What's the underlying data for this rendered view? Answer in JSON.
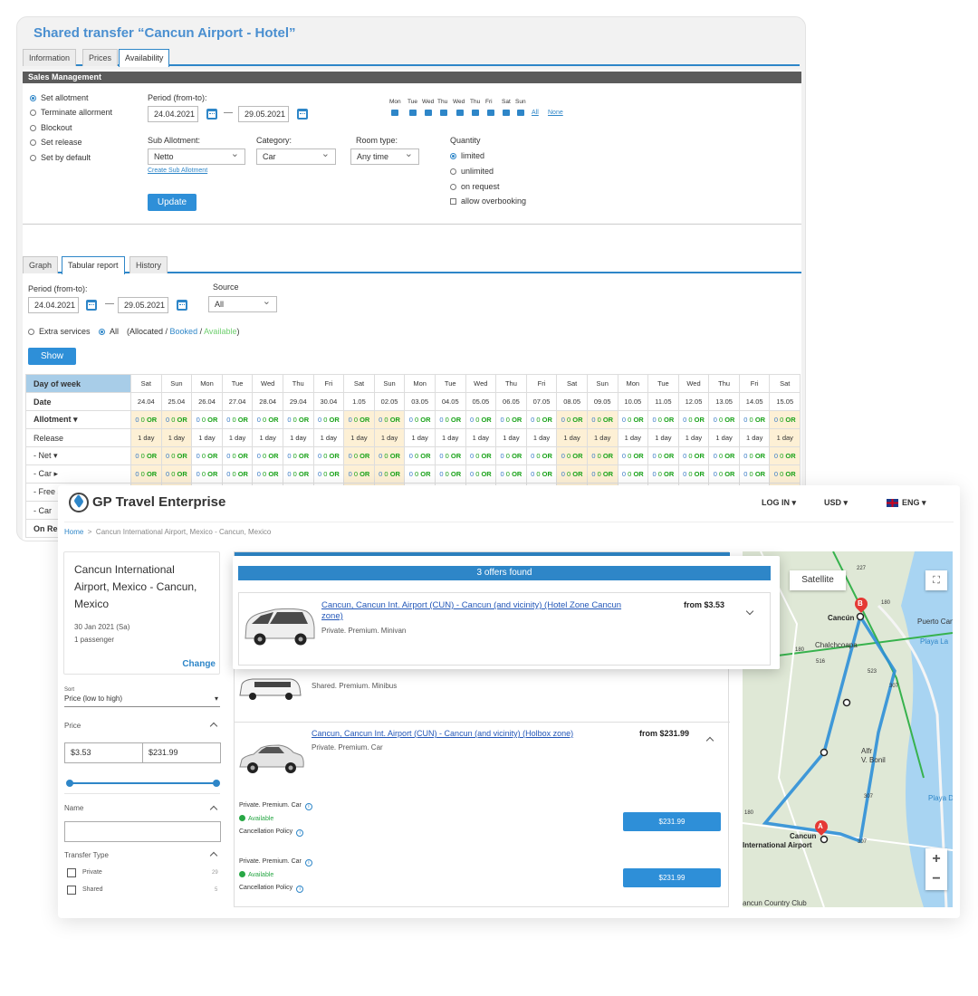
{
  "admin": {
    "title": "Shared transfer “Cancun Airport - Hotel”",
    "tabs": [
      "Information",
      "Prices",
      "Availability"
    ],
    "section_header": "Sales Management",
    "actions": [
      "Set allotment",
      "Terminate allorment",
      "Blockout",
      "Set release",
      "Set by default"
    ],
    "period_label": "Period (from-to):",
    "date_from": "24.04.2021",
    "date_to": "29.05.2021",
    "dash": "—",
    "days": [
      "Mon",
      "Tue",
      "Wed",
      "Thu",
      "Wed",
      "Thu",
      "Fri",
      "Sat",
      "Sun"
    ],
    "days_all": "All",
    "days_none": "None",
    "sub_allotment_label": "Sub Allotment:",
    "sub_allotment_value": "Netto",
    "create_sub_link": "Create Sub Allotment",
    "category_label": "Category:",
    "category_value": "Car",
    "room_type_label": "Room type:",
    "room_type_value": "Any time",
    "quantity_label": "Quantity",
    "quantity_options": [
      "limited",
      "unlimited",
      "on request"
    ],
    "overbooking": "allow overbooking",
    "update_button": "Update",
    "report_tabs": [
      "Graph",
      "Tabular report",
      "History"
    ],
    "source_label": "Source",
    "source_value": "All",
    "extra_services": "Extra services",
    "all_option": "All",
    "legend_open": "(Allocated / ",
    "legend_booked": "Booked",
    "legend_sep": " / ",
    "legend_available": "Available",
    "legend_close": ")",
    "show_button": "Show"
  },
  "report": {
    "row_labels": [
      "Day of week",
      "Date",
      "Allotment ▾",
      "Release",
      "- Net ▾",
      "- Car ▸",
      "- Free sale TO ▾",
      "- Car",
      "On Re"
    ],
    "weekdays": [
      "Sat",
      "Sun",
      "Mon",
      "Tue",
      "Wed",
      "Thu",
      "Fri",
      "Sat",
      "Sun",
      "Mon",
      "Tue",
      "Wed",
      "Thu",
      "Fri",
      "Sat",
      "Sun",
      "Mon",
      "Tue",
      "Wed",
      "Thu",
      "Fri",
      "Sat"
    ],
    "dates": [
      "24.04",
      "25.04",
      "26.04",
      "27.04",
      "28.04",
      "29.04",
      "30.04",
      "1.05",
      "02.05",
      "03.05",
      "04.05",
      "05.05",
      "06.05",
      "07.05",
      "08.05",
      "09.05",
      "10.05",
      "11.05",
      "12.05",
      "13.05",
      "14.05",
      "15.05"
    ],
    "release_value": "1 day",
    "cell_zero": "0",
    "cell_or": "OR"
  },
  "front": {
    "brand": "GP Travel Enterprise",
    "login": "LOG IN",
    "currency": "USD",
    "language": "ENG",
    "crumb_home": "Home",
    "crumb_sep": ">",
    "crumb_current": "Cancun International Airport, Mexico - Cancun, Mexico",
    "route": "Cancun International Airport, Mexico - Cancun, Mexico",
    "trip_date": "30 Jan 2021 (Sa)",
    "passengers": "1 passenger",
    "change": "Change",
    "sort_label": "Sort",
    "sort_value": "Price (low to high)",
    "price_label": "Price",
    "price_min": "$3.53",
    "price_max": "$231.99",
    "name_label": "Name",
    "transfer_type_label": "Transfer Type",
    "transfer_types": [
      {
        "label": "Private",
        "count": "29"
      },
      {
        "label": "Shared",
        "count": "5"
      }
    ],
    "offers_found": "3 offers found",
    "offers": [
      {
        "title": "Cancun, Cancun Int. Airport (CUN) - Cancun (and vicinity) (Hotel Zone Cancun zone)",
        "type": "Private. Premium. Minivan",
        "price": "from $3.53"
      },
      {
        "type": "Shared. Premium. Minibus"
      },
      {
        "title": "Cancun, Cancun Int. Airport (CUN) - Cancun (and vicinity) (Holbox zone)",
        "type": "Private. Premium. Car",
        "price": "from $231.99"
      }
    ],
    "variants": [
      {
        "name": "Private. Premium. Car",
        "status": "Available",
        "policy": "Cancellation Policy",
        "price": "$231.99"
      },
      {
        "name": "Private. Premium. Car",
        "status": "Available",
        "policy": "Cancellation Policy",
        "price": "$231.99"
      }
    ],
    "map": {
      "satellite": "Satellite",
      "labels": [
        "Cancún",
        "Chalchcoapa",
        "Puerto Canc",
        "Playa La",
        "Alfr",
        "V. Bonil",
        "Playa D",
        "Cancun",
        "International Airport",
        "ancun Country Club"
      ],
      "road_labels": [
        "227",
        "180",
        "180",
        "307",
        "307",
        "180",
        "307",
        "516",
        "523"
      ],
      "marker_a": "A",
      "marker_b": "B",
      "zoom_in": "+",
      "zoom_out": "−"
    }
  },
  "colors": {
    "accent": "#2e86c8",
    "available": "#28a745",
    "or_green": "#1aa31a",
    "weekend": "#fdf0d5",
    "header_blue": "#a8cde8"
  }
}
